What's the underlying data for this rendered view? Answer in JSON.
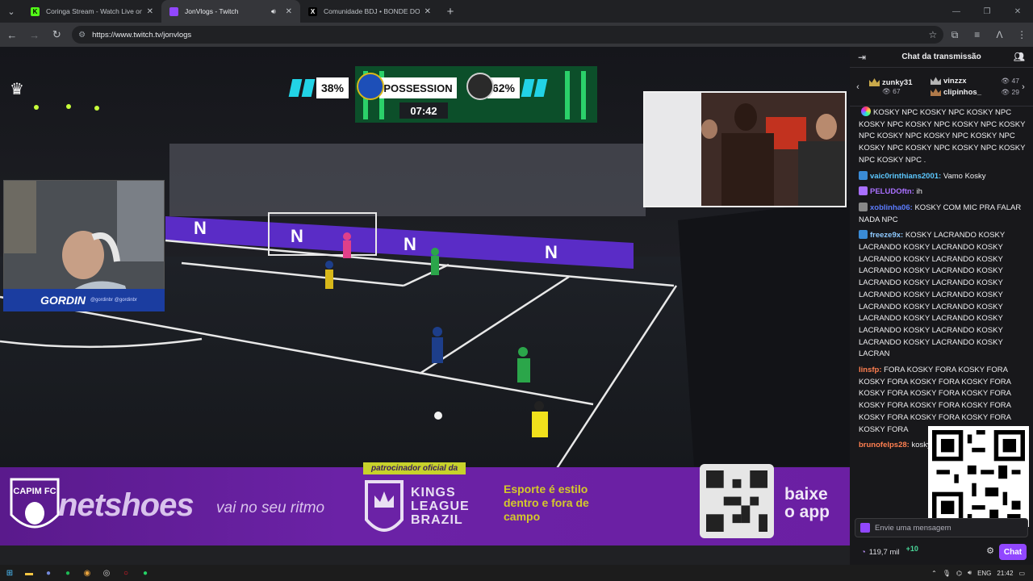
{
  "browser": {
    "tabs": [
      {
        "title": "Coringa Stream - Watch Live on",
        "favicon_color": "#53fc18",
        "favicon_glyph": "K",
        "active": false
      },
      {
        "title": "JonVlogs - Twitch",
        "favicon_color": "#9147ff",
        "favicon_glyph": "",
        "active": true
      },
      {
        "title": "Comunidade BDJ • BONDE DO",
        "favicon_color": "#000000",
        "favicon_glyph": "X",
        "active": false
      }
    ],
    "url": "https://www.twitch.tv/jonvlogs"
  },
  "video": {
    "scoreboard": {
      "left_pct": "38%",
      "label": "POSSESSION",
      "right_pct": "62%",
      "time": "07:42"
    },
    "streamer_name": "GORDIN",
    "streamer_handles": "@gordinbr  @gordinbr",
    "ad": {
      "brand": "netshoes",
      "tagline": "vai no seu ritmo",
      "sponsor_label": "patrocinador oficial da",
      "league_line1": "KINGS",
      "league_line2": "LEAGUE",
      "league_line3": "BRAZIL",
      "esporte": "Esporte é estilo dentro e fora de campo",
      "baixe_line1": "baixe",
      "baixe_line2": "o app",
      "left_team": "CAPIM FC"
    },
    "board_letter": "N"
  },
  "chat": {
    "header": "Chat da transmissão",
    "gifters": [
      {
        "name": "zunky31",
        "count": "67"
      },
      {
        "name": "vinzzx",
        "count": "47"
      },
      {
        "name": "clipinhos_",
        "count": "29"
      }
    ],
    "messages": [
      {
        "user": "",
        "color": "#efeff1",
        "text": "KOSKY NPC  KOSKY NPC  KOSKY NPC  KOSKY NPC  KOSKY NPC  KOSKY NPC  KOSKY NPC  KOSKY NPC  KOSKY NPC  KOSKY NPC  KOSKY NPC  KOSKY NPC  KOSKY NPC  KOSKY NPC  KOSKY NPC ."
      },
      {
        "user": "vaic0rinthians2001:",
        "color": "#5cc8ff",
        "text": "Vamo Kosky"
      },
      {
        "user": "PELUDOftn:",
        "color": "#a970ff",
        "text": "ih"
      },
      {
        "user": "xoblinha06:",
        "color": "#5c7cff",
        "text": "KOSKY COM MIC PRA FALAR NADA NPC"
      },
      {
        "user": "freeze9x:",
        "color": "#1e90ff",
        "text": "KOSKY LACRANDO  KOSKY LACRANDO  KOSKY LACRANDO  KOSKY LACRANDO  KOSKY LACRANDO  KOSKY LACRANDO  KOSKY LACRANDO  KOSKY LACRANDO  KOSKY LACRANDO  KOSKY LACRANDO  KOSKY LACRANDO  KOSKY LACRANDO  KOSKY LACRANDO  KOSKY LACRANDO  KOSKY LACRANDO  KOSKY LACRANDO  KOSKY LACRANDO  KOSKY LACRANDO  KOSKY LACRANDO  KOSKY LACRAN"
      },
      {
        "user": "linsfp:",
        "color": "#ff7f50",
        "text": "FORA KOSKY FORA KOSKY FORA KOSKY FORA KOSKY FORA KOSKY FORA KOSKY FORA KOSKY FORA KOSKY FORA KOSKY FORA KOSKY FORA KOSKY FORA KOSKY FORA KOSKY FORA KOSKY FORA KOSKY FORA"
      },
      {
        "user": "brunofelps28:",
        "color": "#ff7f50",
        "text": "kosky"
      }
    ],
    "input_placeholder": "Envie uma mensagem",
    "points": "119,7 mil",
    "points_plus": "+10",
    "chat_button": "Chat"
  },
  "taskbar": {
    "lang": "ENG",
    "time": "21:42"
  }
}
